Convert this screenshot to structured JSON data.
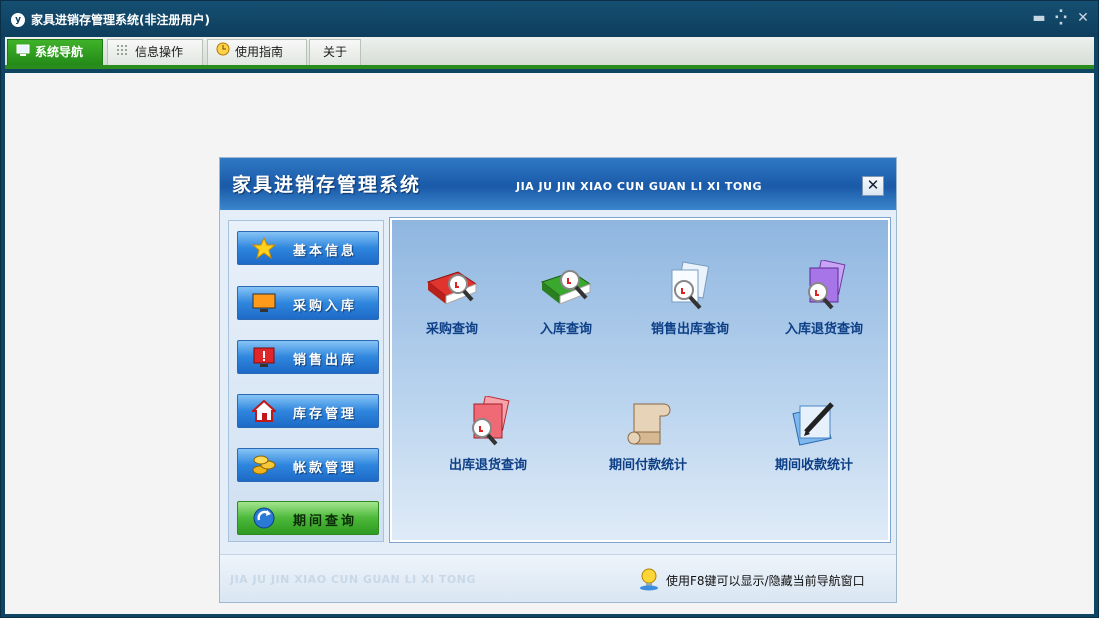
{
  "window": {
    "logo_text": "y",
    "title": "家具进销存管理系统(非注册用户)",
    "controls": {
      "minimize": "▬",
      "restore": "⁛",
      "close": "✕"
    }
  },
  "tabs": [
    {
      "label": "系统导航",
      "icon": "monitor-icon",
      "active": true
    },
    {
      "label": "信息操作",
      "icon": "grid-icon",
      "active": false
    },
    {
      "label": "使用指南",
      "icon": "clock-icon",
      "active": false
    },
    {
      "label": "关于",
      "icon": "",
      "active": false
    }
  ],
  "panel": {
    "title": "家具进销存管理系统",
    "subtitle": "JIA JU JIN XIAO CUN  GUAN LI XI TONG",
    "close": "✕"
  },
  "nav": [
    {
      "label": "基本信息",
      "icon": "star-icon"
    },
    {
      "label": "采购入库",
      "icon": "monitor-icon"
    },
    {
      "label": "销售出库",
      "icon": "alert-monitor-icon"
    },
    {
      "label": "库存管理",
      "icon": "home-icon"
    },
    {
      "label": "帐款管理",
      "icon": "coins-icon"
    },
    {
      "label": "期间查询",
      "icon": "refresh-arrow-icon",
      "highlight": "green"
    }
  ],
  "queries": [
    {
      "label": "采购查询",
      "icon": "red-book-search-icon"
    },
    {
      "label": "入库查询",
      "icon": "green-book-search-icon"
    },
    {
      "label": "销售出库查询",
      "icon": "documents-search-icon"
    },
    {
      "label": "入库退货查询",
      "icon": "purple-folder-search-icon"
    },
    {
      "label": "出库退货查询",
      "icon": "red-folder-search-icon"
    },
    {
      "label": "期间付款统计",
      "icon": "scroll-icon"
    },
    {
      "label": "期间收款统计",
      "icon": "pen-document-icon"
    }
  ],
  "footer": {
    "watermark": "JIA JU JIN XIAO CUN GUAN LI XI TONG",
    "tip": "使用F8键可以显示/隐藏当前导航窗口"
  },
  "colors": {
    "title_bar": "#0e3e5d",
    "active_tab": "#2a8c1c",
    "panel_header": "#1a5aa8",
    "query_label": "#0d3f86"
  }
}
